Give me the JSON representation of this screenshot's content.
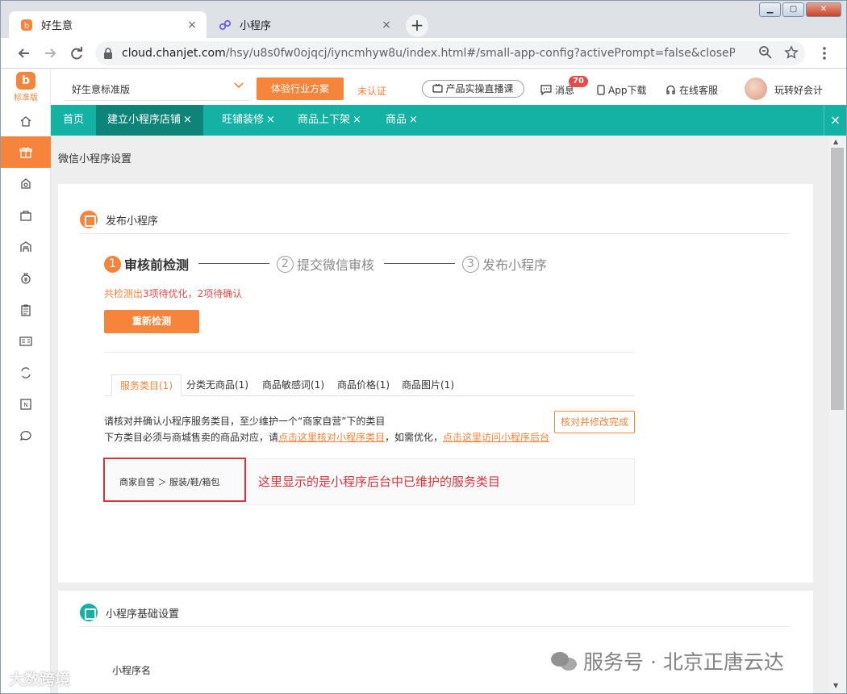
{
  "browser": {
    "tabs": [
      {
        "title": "好生意",
        "close": "×"
      },
      {
        "title": "小程序",
        "close": "×"
      }
    ],
    "newtab": "+",
    "winbtns": {
      "minimize": "▁",
      "maximize": "▢",
      "close": "✕"
    },
    "url_host": "cloud.chanjet.com",
    "url_path": "/hsy/u8s0fw0ojqcj/iyncmhyw8u/index.html#/small-app-config?activePrompt=false&closeProm..."
  },
  "sidebar": {
    "logo_letter": "b",
    "logo_tag": "标准版"
  },
  "topbar": {
    "edition": "好生意标准版",
    "try_button": "体验行业方案",
    "unverified": "未认证",
    "live_button": "产品实操直播课",
    "message": "消息",
    "message_count": "70",
    "app_download": "App下载",
    "online_service": "在线客服",
    "user": "玩转好会计"
  },
  "nav_tabs": [
    {
      "label": "首页",
      "closable": ""
    },
    {
      "label": "建立小程序店铺",
      "closable": "×"
    },
    {
      "label": "旺铺装修",
      "closable": "×"
    },
    {
      "label": "商品上下架",
      "closable": "×"
    },
    {
      "label": "商品",
      "closable": "×"
    }
  ],
  "nav_close": "×",
  "main": {
    "crumb": "微信小程序设置",
    "publish": {
      "title": "发布小程序",
      "steps": [
        {
          "num": "1",
          "label": "审核前检测"
        },
        {
          "num": "2",
          "label": "提交微信审核"
        },
        {
          "num": "3",
          "label": "发布小程序"
        }
      ],
      "detect_prefix": "共检测出",
      "detect_result": "3项待优化，2项待确认",
      "recheck_button": "重新检测",
      "subtabs": [
        "服务类目(1)",
        "分类无商品(1)",
        "商品敏感词(1)",
        "商品价格(1)",
        "商品图片(1)"
      ],
      "verify_button": "核对并修改完成",
      "desc_line1": "请核对并确认小程序服务类目，至少维护一个“商家自营”下的类目",
      "desc_line2_a": "下方类目必须与商城售卖的商品对应，请",
      "desc_line2_link1": "点击这里核对小程序类目",
      "desc_line2_b": "，如需优化，",
      "desc_line2_link2": "点击这里访问小程序后台",
      "category": "商家自营 ＞ 服装/鞋/箱包",
      "annotation": "这里显示的是小程序后台中已维护的服务类目"
    },
    "basic": {
      "title": "小程序基础设置",
      "name_label": "小程序名"
    }
  },
  "watermark": "服务号 · 北京正唐云达",
  "watermark2": "大数跨境",
  "colors": {
    "accent": "#f7843b",
    "teal": "#14b2a4",
    "alert": "#d9333f"
  }
}
